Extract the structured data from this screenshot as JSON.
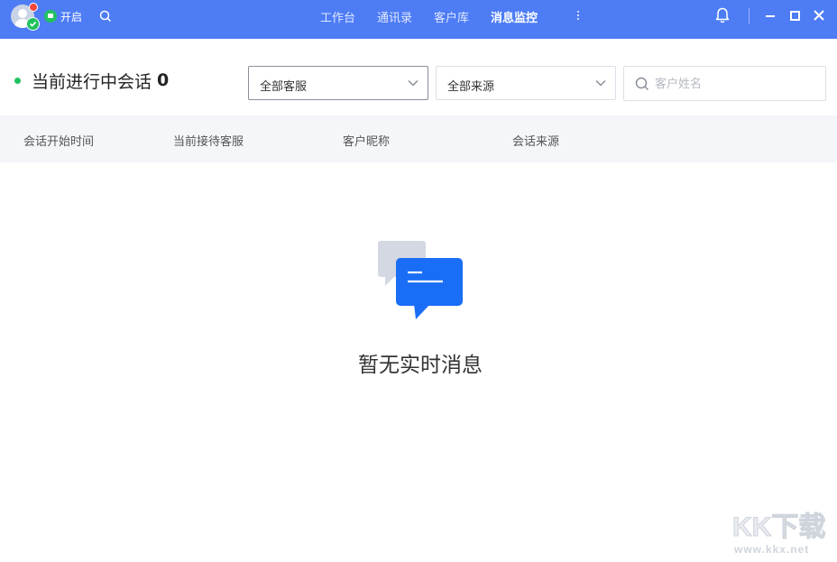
{
  "titlebar": {
    "status_label": "开启",
    "tabs": [
      {
        "label": "工作台",
        "active": false
      },
      {
        "label": "通讯录",
        "active": false
      },
      {
        "label": "客户库",
        "active": false
      },
      {
        "label": "消息监控",
        "active": true
      }
    ]
  },
  "header": {
    "session_label": "当前进行中会话",
    "session_count": "0",
    "agent_select": {
      "value": "全部客服"
    },
    "source_select": {
      "value": "全部来源"
    },
    "search": {
      "placeholder": "客户姓名",
      "value": ""
    }
  },
  "table": {
    "columns": [
      "会话开始时间",
      "当前接待客服",
      "客户昵称",
      "会话来源"
    ]
  },
  "empty_state": {
    "message": "暂无实时消息"
  },
  "watermark": {
    "logo_chars": [
      "K",
      "K",
      "下",
      "载"
    ],
    "url": "www.kkx.net"
  },
  "colors": {
    "titlebar_bg": "#4d7cf5",
    "online_green": "#21c25e",
    "empty_icon_blue": "#1a6ef5",
    "empty_icon_gray": "#d3d8e2"
  },
  "icons": {
    "avatar": "user-avatar-icon",
    "status": "chat-status-icon",
    "search": "search-icon",
    "more": "more-vertical-icon",
    "bell": "bell-icon",
    "minimize": "minimize-icon",
    "maximize": "maximize-icon",
    "close": "close-icon"
  }
}
